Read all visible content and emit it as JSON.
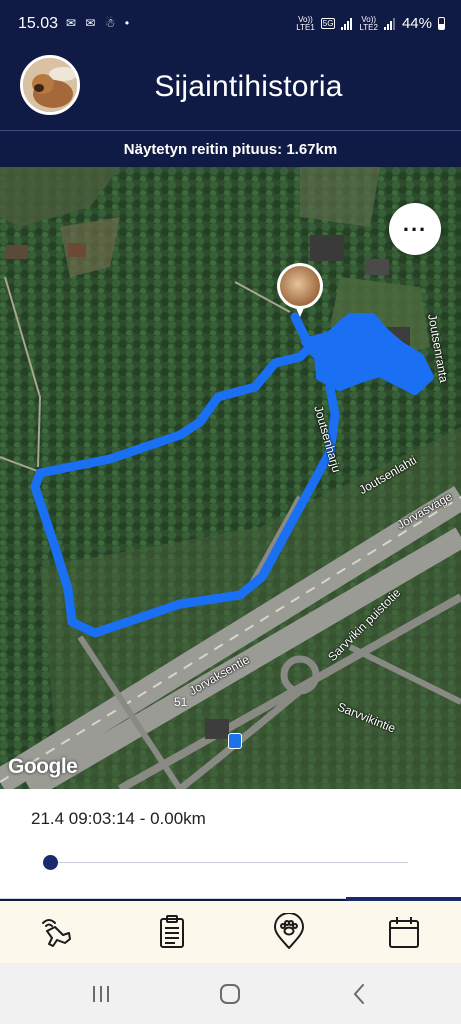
{
  "status_bar": {
    "time": "15.03",
    "notification_icons": "✉ ✉ ☃ •",
    "sim1_label_top": "Vo))",
    "sim1_label_bottom": "LTE1",
    "network_badge": "5G",
    "sim2_label_top": "Vo))",
    "sim2_label_bottom": "LTE2",
    "battery_percent": "44%"
  },
  "header": {
    "title": "Sijaintihistoria",
    "avatar_icon": "pet-avatar"
  },
  "route": {
    "length_label": "Näytetyn reitin pituus: 1.67km"
  },
  "map": {
    "more_button_icon": "more-horizontal-icon",
    "attribution": "Google",
    "streets": {
      "joutsenharju": "Joutsenharju",
      "joutsenlahti": "Joutsenlahti",
      "jorvasvagen": "Jorvasväge",
      "sarvvikin_puistotie": "Sarvvikin puistotie",
      "jorvaksentie": "Jorvaksentie",
      "sarvvikintie": "Sarvvikintie",
      "joutsenranta": "Joutsenranta"
    },
    "road_number": "51",
    "route_color": "#1a6ff2"
  },
  "timeline": {
    "label": "21.4 09:03:14 - 0.00km",
    "position": 0.0
  },
  "bottom_nav": {
    "items": [
      {
        "icon": "live-tracking-icon",
        "active": false
      },
      {
        "icon": "clipboard-icon",
        "active": false
      },
      {
        "icon": "paw-location-icon",
        "active": false
      },
      {
        "icon": "calendar-icon",
        "active": true
      }
    ]
  },
  "system_nav": {
    "recents_icon": "recents-icon",
    "home_icon": "home-icon",
    "back_icon": "back-icon"
  },
  "colors": {
    "header_bg": "#0f1a45",
    "accent": "#1a2a6c",
    "nav_bg": "#fdf8ec"
  }
}
